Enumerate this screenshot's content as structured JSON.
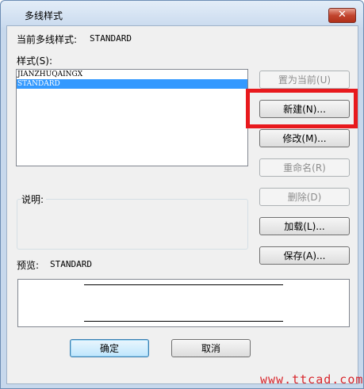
{
  "window": {
    "title": "多线样式",
    "close_symbol": "✕"
  },
  "current_style": {
    "label": "当前多线样式:",
    "value": "STANDARD"
  },
  "styles_label": "样式(S):",
  "styles": [
    "JIANZHUQAINGX",
    "STANDARD"
  ],
  "selected_style": "STANDARD",
  "description_label": "说明:",
  "preview": {
    "label": "预览:",
    "value": "STANDARD"
  },
  "buttons": {
    "set_current": "置为当前(U)",
    "new": "新建(N)...",
    "modify": "修改(M)...",
    "rename": "重命名(R)",
    "delete": "删除(D)",
    "load": "加载(L)...",
    "save": "保存(A)...",
    "ok": "确定",
    "cancel": "取消"
  },
  "watermark": "www.ttcad.com",
  "colors": {
    "selection": "#3399ff",
    "highlight_box": "#e8191d",
    "watermark": "#d8262c"
  }
}
